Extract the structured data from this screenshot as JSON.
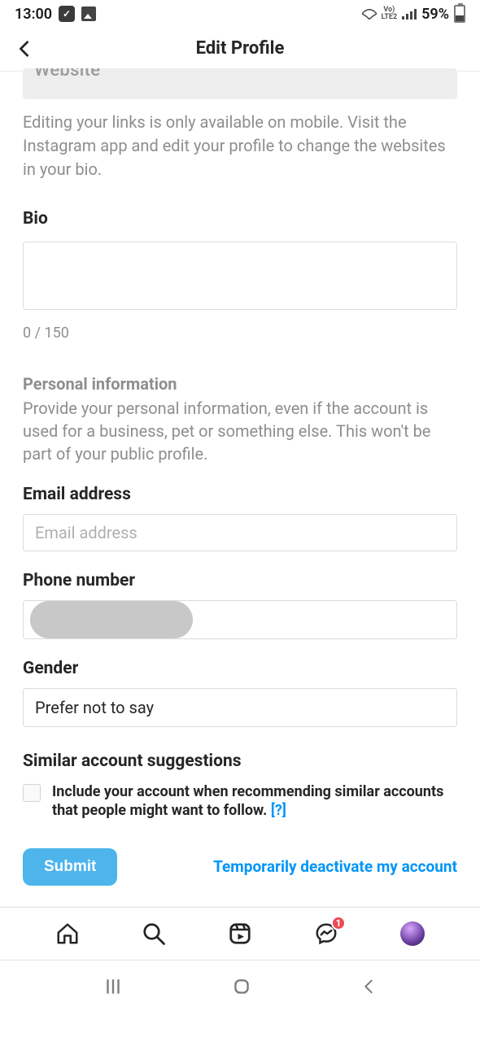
{
  "status": {
    "time": "13:00",
    "battery": "59%",
    "lteLabel": "LTE2",
    "voLabel": "Vo)"
  },
  "header": {
    "title": "Edit Profile"
  },
  "website": {
    "placeholder": "Website"
  },
  "websiteInfo": "Editing your links is only available on mobile. Visit the Instagram app and edit your profile to change the websites in your bio.",
  "bio": {
    "label": "Bio",
    "value": "",
    "counter": "0 / 150"
  },
  "personal": {
    "header": "Personal information",
    "desc": "Provide your personal information, even if the account is used for a business, pet or something else. This won't be part of your public profile."
  },
  "email": {
    "label": "Email address",
    "placeholder": "Email address",
    "value": ""
  },
  "phone": {
    "label": "Phone number"
  },
  "gender": {
    "label": "Gender",
    "value": "Prefer not to say"
  },
  "suggestions": {
    "label": "Similar account suggestions",
    "checkboxText": "Include your account when recommending similar accounts that people might want to follow.",
    "help": "[?]"
  },
  "actions": {
    "submit": "Submit",
    "deactivate": "Temporarily deactivate my account"
  },
  "bottomNav": {
    "messengerBadge": "1"
  }
}
